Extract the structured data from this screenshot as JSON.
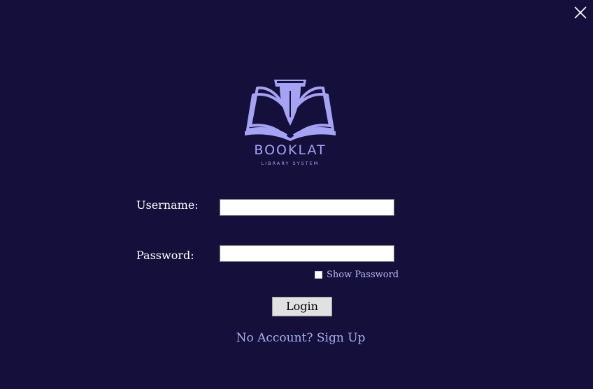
{
  "window": {
    "close_icon": "close-icon"
  },
  "logo": {
    "icon": "open-book-pen-icon",
    "brand": "BOOKLAT",
    "tagline": "LIBRARY SYSTEM",
    "color": "#a6a3f5"
  },
  "form": {
    "username_label": "Username:",
    "username_value": "",
    "password_label": "Password:",
    "password_value": "",
    "show_password_label": "Show Password",
    "show_password_checked": false,
    "login_label": "Login",
    "signup_link": "No Account? Sign Up"
  },
  "colors": {
    "background": "#150f3b",
    "link": "#a6b0ee"
  }
}
